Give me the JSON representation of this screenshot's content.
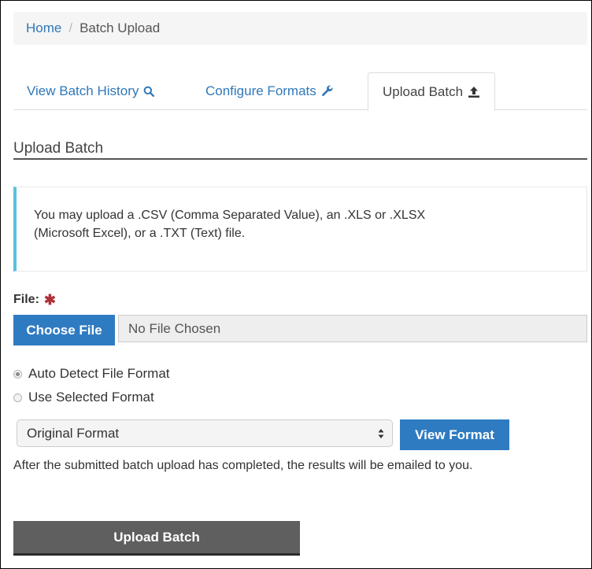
{
  "breadcrumb": {
    "home": "Home",
    "separator": "/",
    "current": "Batch Upload"
  },
  "tabs": [
    {
      "label": "View Batch History",
      "icon": "search-icon",
      "active": false
    },
    {
      "label": "Configure Formats",
      "icon": "wrench-icon",
      "active": false
    },
    {
      "label": "Upload Batch",
      "icon": "upload-icon",
      "active": true
    }
  ],
  "section": {
    "title": "Upload Batch"
  },
  "info": {
    "line1": "You may upload a .CSV (Comma Separated Value), an .XLS or .XLSX",
    "line2": "(Microsoft Excel), or a .TXT (Text) file."
  },
  "file": {
    "label": "File:",
    "required_mark": "✱",
    "choose_button": "Choose File",
    "chosen_text": "No File Chosen"
  },
  "format_options": {
    "auto_detect": "Auto Detect File Format",
    "use_selected": "Use Selected Format",
    "selected": "auto_detect"
  },
  "format_select": {
    "value": "Original Format",
    "view_button": "View Format"
  },
  "note": "After the submitted batch upload has completed, the results will be emailed to you.",
  "submit": {
    "label": "Upload Batch"
  },
  "colors": {
    "link": "#2f78b8",
    "primary_button": "#2f7bc2",
    "info_accent": "#5bc0de",
    "submit_button": "#5f5f5f",
    "required": "#b0303a"
  }
}
